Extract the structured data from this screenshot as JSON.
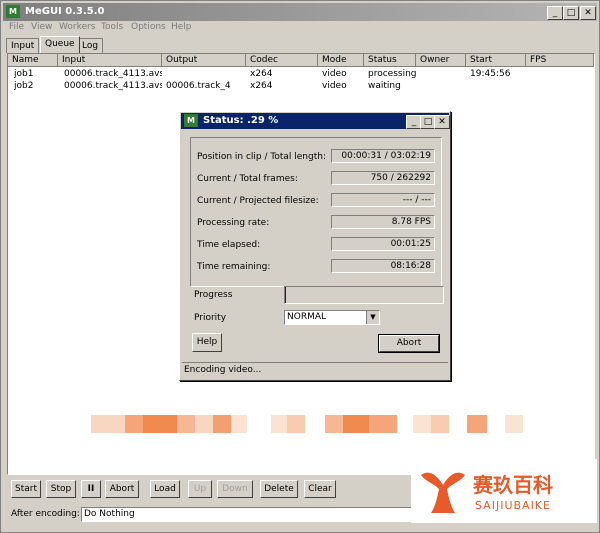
{
  "app": {
    "icon_text": "M",
    "title": "MeGUI 0.3.5.0"
  },
  "menu": [
    "File",
    "View",
    "Workers",
    "Tools",
    "Options",
    "Help"
  ],
  "tabs": [
    "Input",
    "Queue",
    "Log"
  ],
  "active_tab": "Queue",
  "queue": {
    "columns": [
      "Name",
      "Input",
      "Output",
      "Codec",
      "Mode",
      "Status",
      "Owner",
      "Start",
      "FPS"
    ],
    "rows": [
      {
        "name": "job1",
        "input": "00006.track_4113.avs",
        "output": "",
        "codec": "x264",
        "mode": "video",
        "status": "processing",
        "owner": "",
        "start": "19:45:56",
        "fps": ""
      },
      {
        "name": "job2",
        "input": "00006.track_4113.avs",
        "output": "00006.track_4",
        "codec": "x264",
        "mode": "video",
        "status": "waiting",
        "owner": "",
        "start": "",
        "fps": ""
      }
    ]
  },
  "status_dialog": {
    "icon_text": "M",
    "title": "Status: .29 %",
    "stats": [
      {
        "label": "Position in clip / Total length:",
        "value": "00:00:31 / 03:02:19"
      },
      {
        "label": "Current / Total frames:",
        "value": "750 / 262292"
      },
      {
        "label": "Current / Projected filesize:",
        "value": "--- / ---"
      },
      {
        "label": "Processing rate:",
        "value": "8.78 FPS"
      },
      {
        "label": "Time elapsed:",
        "value": "00:01:25"
      },
      {
        "label": "Time remaining:",
        "value": "08:16:28"
      }
    ],
    "progress_label": "Progress",
    "progress_value": 0.0029,
    "priority_label": "Priority",
    "priority_value": "NORMAL",
    "help_label": "Help",
    "abort_label": "Abort",
    "status_text": "Encoding video..."
  },
  "toolbar": {
    "start": "Start",
    "stop": "Stop",
    "pause": "II",
    "abort": "Abort",
    "load": "Load",
    "up": "Up",
    "down": "Down",
    "delete": "Delete",
    "clear": "Clear"
  },
  "after_encoding": {
    "label": "After encoding:",
    "value": "Do Nothing"
  },
  "watermark": {
    "cn": "赛玖百科",
    "en": "SAIJIUBAIKE"
  },
  "colors": {
    "titlebar_active": "#0a246a",
    "watermark": "#e85a2a"
  }
}
